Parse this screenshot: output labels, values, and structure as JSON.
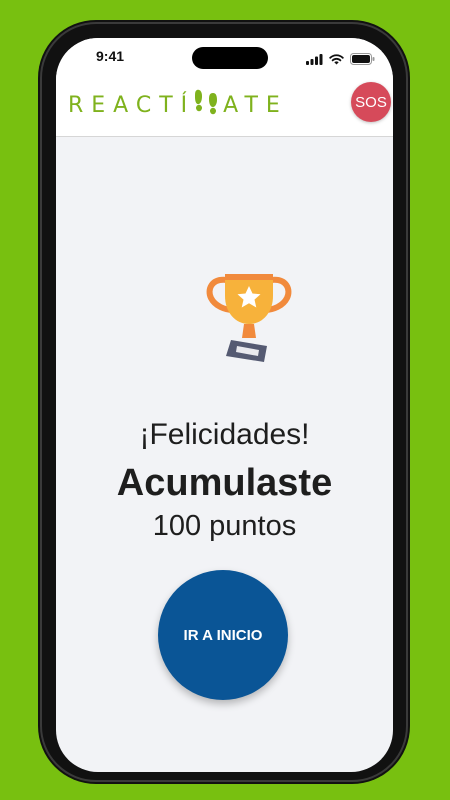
{
  "status_bar": {
    "time": "9:41"
  },
  "header": {
    "logo_left": "REACTÍ",
    "logo_right": "ATE",
    "sos_label": "SOS"
  },
  "main": {
    "congrats": "¡Felicidades!",
    "headline": "Acumulaste",
    "points": "100 puntos",
    "home_button": "IR A INICIO"
  },
  "icons": {
    "logo_mark": "footprints-icon",
    "trophy": "trophy-icon",
    "signal": "signal-icon",
    "wifi": "wifi-icon",
    "battery": "battery-icon"
  },
  "colors": {
    "background": "#78c010",
    "brand_green": "#7fb21d",
    "sos_red": "#d64a5a",
    "button_blue": "#0a5596",
    "trophy_orange": "#f18a3c",
    "trophy_gold": "#f7b23b"
  }
}
